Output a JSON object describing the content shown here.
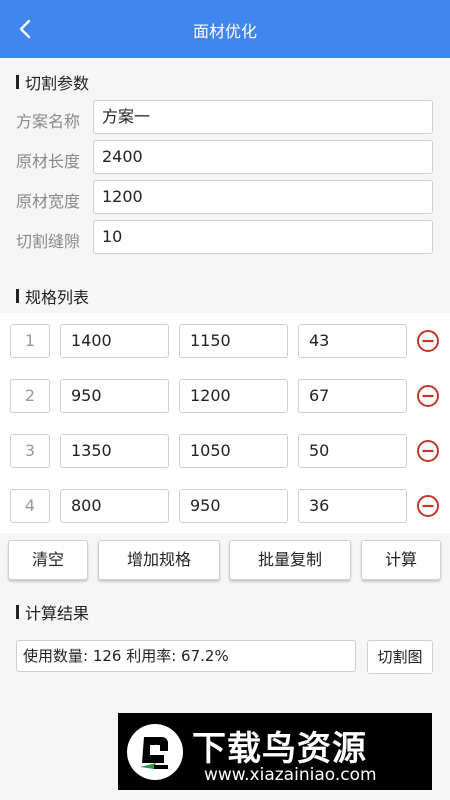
{
  "header": {
    "title": "面材优化"
  },
  "params": {
    "section_title": "切割参数",
    "fields": [
      {
        "label": "方案名称",
        "value": "方案一"
      },
      {
        "label": "原材长度",
        "value": "2400"
      },
      {
        "label": "原材宽度",
        "value": "1200"
      },
      {
        "label": "切割缝隙",
        "value": "10"
      }
    ]
  },
  "specs": {
    "section_title": "规格列表",
    "rows": [
      {
        "index": "1",
        "length": "1400",
        "width": "1150",
        "qty": "43"
      },
      {
        "index": "2",
        "length": "950",
        "width": "1200",
        "qty": "67"
      },
      {
        "index": "3",
        "length": "1350",
        "width": "1050",
        "qty": "50"
      },
      {
        "index": "4",
        "length": "800",
        "width": "950",
        "qty": "36"
      }
    ]
  },
  "actions": {
    "clear": "清空",
    "add": "增加规格",
    "batch_copy": "批量复制",
    "calculate": "计算"
  },
  "result": {
    "section_title": "计算结果",
    "summary": "使用数量: 126  利用率: 67.2%",
    "cut_button": "切割图"
  },
  "watermark": {
    "text": "下载鸟资源",
    "url": "www.xiazainiao.com"
  },
  "colors": {
    "header": "#3f86ee",
    "remove": "#c0392b"
  }
}
